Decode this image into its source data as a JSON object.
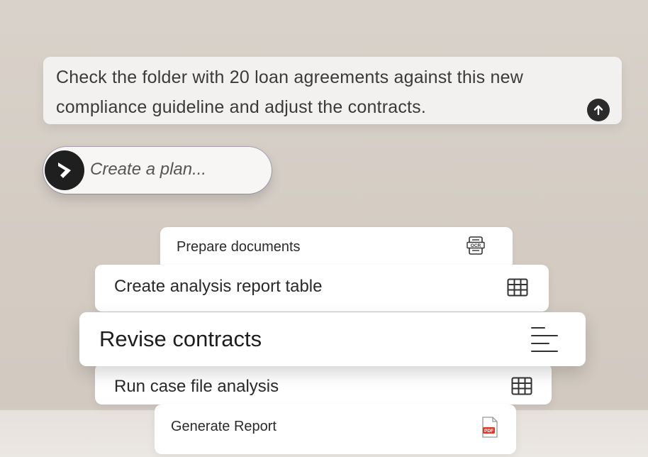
{
  "prompt": {
    "text": "Check the folder with 20 loan agreements against this new compliance guideline and adjust the contracts.",
    "send_icon": "arrow-up-icon"
  },
  "plan_button": {
    "label": "Create a plan...",
    "icon": "chevron-right-icon"
  },
  "tasks": [
    {
      "label": "Prepare documents",
      "icon": "ocr-document-icon"
    },
    {
      "label": "Create analysis report table",
      "icon": "table-icon"
    },
    {
      "label": "Revise contracts",
      "icon": "text-align-left-icon"
    },
    {
      "label": "Run case file analysis",
      "icon": "table-icon"
    },
    {
      "label": "Generate Report",
      "icon": "pdf-file-icon"
    }
  ],
  "colors": {
    "background": "#d6cfc7",
    "card": "#ffffff",
    "dark": "#1f1f1f",
    "pdf_red": "#e0392b"
  }
}
